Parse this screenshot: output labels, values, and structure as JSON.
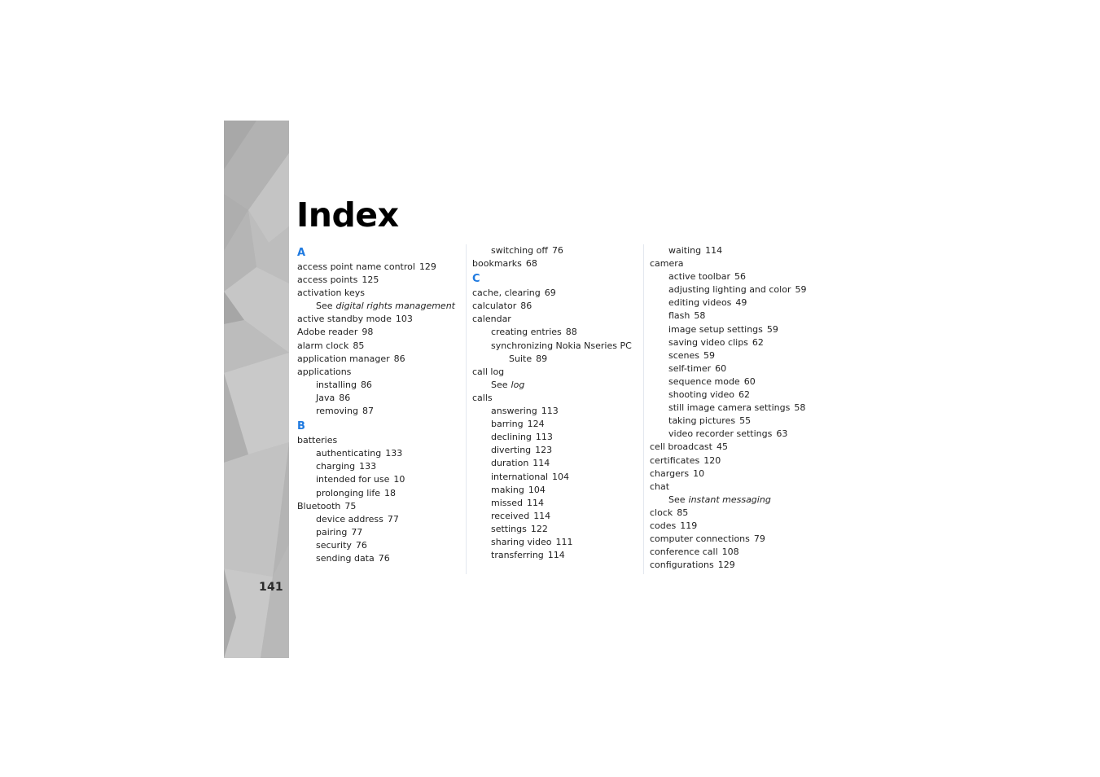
{
  "document": {
    "title": "Index",
    "page_number": "141",
    "accent_color": "#1f7ae0"
  },
  "columns": [
    {
      "entries": [
        {
          "type": "letter",
          "text": "A"
        },
        {
          "type": "entry",
          "level": 0,
          "text": "access point name control",
          "page": "129"
        },
        {
          "type": "entry",
          "level": 0,
          "text": "access points",
          "page": "125"
        },
        {
          "type": "entry",
          "level": 0,
          "text": "activation keys",
          "page": ""
        },
        {
          "type": "see",
          "level": 1,
          "see": "See",
          "target": "digital rights management"
        },
        {
          "type": "entry",
          "level": 0,
          "text": "active standby mode",
          "page": "103"
        },
        {
          "type": "entry",
          "level": 0,
          "text": "Adobe reader",
          "page": "98"
        },
        {
          "type": "entry",
          "level": 0,
          "text": "alarm clock",
          "page": "85"
        },
        {
          "type": "entry",
          "level": 0,
          "text": "application manager",
          "page": "86"
        },
        {
          "type": "entry",
          "level": 0,
          "text": "applications",
          "page": ""
        },
        {
          "type": "entry",
          "level": 1,
          "text": "installing",
          "page": "86"
        },
        {
          "type": "entry",
          "level": 1,
          "text": "Java",
          "page": "86"
        },
        {
          "type": "entry",
          "level": 1,
          "text": "removing",
          "page": "87"
        },
        {
          "type": "letter",
          "text": "B"
        },
        {
          "type": "entry",
          "level": 0,
          "text": "batteries",
          "page": ""
        },
        {
          "type": "entry",
          "level": 1,
          "text": "authenticating",
          "page": "133"
        },
        {
          "type": "entry",
          "level": 1,
          "text": "charging",
          "page": "133"
        },
        {
          "type": "entry",
          "level": 1,
          "text": "intended for use",
          "page": "10"
        },
        {
          "type": "entry",
          "level": 1,
          "text": "prolonging life",
          "page": "18"
        },
        {
          "type": "entry",
          "level": 0,
          "text": "Bluetooth",
          "page": "75"
        },
        {
          "type": "entry",
          "level": 1,
          "text": "device address",
          "page": "77"
        },
        {
          "type": "entry",
          "level": 1,
          "text": "pairing",
          "page": "77"
        },
        {
          "type": "entry",
          "level": 1,
          "text": "security",
          "page": "76"
        },
        {
          "type": "entry",
          "level": 1,
          "text": "sending data",
          "page": "76"
        }
      ]
    },
    {
      "entries": [
        {
          "type": "entry",
          "level": 1,
          "text": "switching off",
          "page": "76"
        },
        {
          "type": "entry",
          "level": 0,
          "text": "bookmarks",
          "page": "68"
        },
        {
          "type": "letter",
          "text": "C"
        },
        {
          "type": "entry",
          "level": 0,
          "text": "cache, clearing",
          "page": "69"
        },
        {
          "type": "entry",
          "level": 0,
          "text": "calculator",
          "page": "86"
        },
        {
          "type": "entry",
          "level": 0,
          "text": "calendar",
          "page": ""
        },
        {
          "type": "entry",
          "level": 1,
          "text": "creating entries",
          "page": "88"
        },
        {
          "type": "entry",
          "level": 1,
          "text": "synchronizing Nokia Nseries PC",
          "page": ""
        },
        {
          "type": "entry",
          "level": 2,
          "text": "Suite",
          "page": "89"
        },
        {
          "type": "entry",
          "level": 0,
          "text": "call log",
          "page": ""
        },
        {
          "type": "see",
          "level": 1,
          "see": "See",
          "target": "log"
        },
        {
          "type": "entry",
          "level": 0,
          "text": "calls",
          "page": ""
        },
        {
          "type": "entry",
          "level": 1,
          "text": "answering",
          "page": "113"
        },
        {
          "type": "entry",
          "level": 1,
          "text": "barring",
          "page": "124"
        },
        {
          "type": "entry",
          "level": 1,
          "text": "declining",
          "page": "113"
        },
        {
          "type": "entry",
          "level": 1,
          "text": "diverting",
          "page": "123"
        },
        {
          "type": "entry",
          "level": 1,
          "text": "duration",
          "page": "114"
        },
        {
          "type": "entry",
          "level": 1,
          "text": "international",
          "page": "104"
        },
        {
          "type": "entry",
          "level": 1,
          "text": "making",
          "page": "104"
        },
        {
          "type": "entry",
          "level": 1,
          "text": "missed",
          "page": "114"
        },
        {
          "type": "entry",
          "level": 1,
          "text": "received",
          "page": "114"
        },
        {
          "type": "entry",
          "level": 1,
          "text": "settings",
          "page": "122"
        },
        {
          "type": "entry",
          "level": 1,
          "text": "sharing video",
          "page": "111"
        },
        {
          "type": "entry",
          "level": 1,
          "text": "transferring",
          "page": "114"
        }
      ]
    },
    {
      "entries": [
        {
          "type": "entry",
          "level": 1,
          "text": "waiting",
          "page": "114"
        },
        {
          "type": "entry",
          "level": 0,
          "text": "camera",
          "page": ""
        },
        {
          "type": "entry",
          "level": 1,
          "text": "active toolbar",
          "page": "56"
        },
        {
          "type": "entry",
          "level": 1,
          "text": "adjusting lighting and color",
          "page": "59"
        },
        {
          "type": "entry",
          "level": 1,
          "text": "editing videos",
          "page": "49"
        },
        {
          "type": "entry",
          "level": 1,
          "text": "flash",
          "page": "58"
        },
        {
          "type": "entry",
          "level": 1,
          "text": "image setup settings",
          "page": "59"
        },
        {
          "type": "entry",
          "level": 1,
          "text": "saving video clips",
          "page": "62"
        },
        {
          "type": "entry",
          "level": 1,
          "text": "scenes",
          "page": "59"
        },
        {
          "type": "entry",
          "level": 1,
          "text": "self-timer",
          "page": "60"
        },
        {
          "type": "entry",
          "level": 1,
          "text": "sequence mode",
          "page": "60"
        },
        {
          "type": "entry",
          "level": 1,
          "text": "shooting video",
          "page": "62"
        },
        {
          "type": "entry",
          "level": 1,
          "text": "still image camera settings",
          "page": "58"
        },
        {
          "type": "entry",
          "level": 1,
          "text": "taking pictures",
          "page": "55"
        },
        {
          "type": "entry",
          "level": 1,
          "text": "video recorder settings",
          "page": "63"
        },
        {
          "type": "entry",
          "level": 0,
          "text": "cell broadcast",
          "page": "45"
        },
        {
          "type": "entry",
          "level": 0,
          "text": "certificates",
          "page": "120"
        },
        {
          "type": "entry",
          "level": 0,
          "text": "chargers",
          "page": "10"
        },
        {
          "type": "entry",
          "level": 0,
          "text": "chat",
          "page": ""
        },
        {
          "type": "see",
          "level": 1,
          "see": "See",
          "target": "instant messaging"
        },
        {
          "type": "entry",
          "level": 0,
          "text": "clock",
          "page": "85"
        },
        {
          "type": "entry",
          "level": 0,
          "text": "codes",
          "page": "119"
        },
        {
          "type": "entry",
          "level": 0,
          "text": "computer connections",
          "page": "79"
        },
        {
          "type": "entry",
          "level": 0,
          "text": "conference call",
          "page": "108"
        },
        {
          "type": "entry",
          "level": 0,
          "text": "configurations",
          "page": "129"
        }
      ]
    }
  ]
}
